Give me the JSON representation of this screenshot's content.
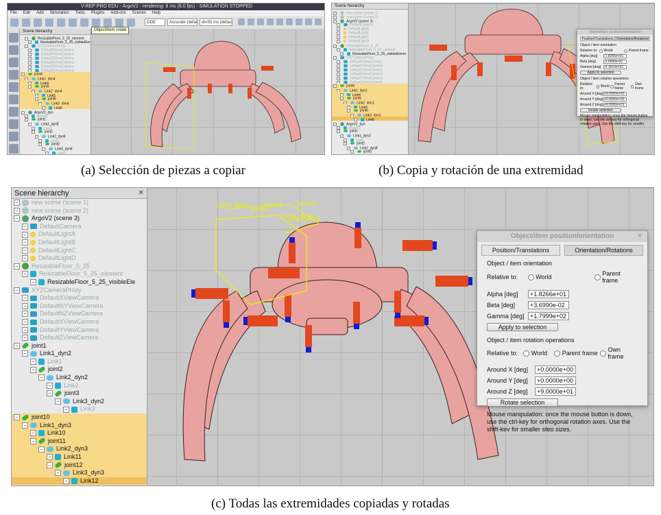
{
  "captions": {
    "a": "(a) Selección de piezas a copiar",
    "b": "(b) Copia y rotación de una extremidad",
    "c": "(c) Todas las extremidades copiadas y rotadas"
  },
  "panel_a": {
    "window_title": "V-REP PRO EDU - ArgoV2 - rendering: 8 ms (8.0 fps) - SIMULATION STOPPED",
    "menu": [
      "File",
      "Edit",
      "Add",
      "Simulation",
      "Tools",
      "Plugins",
      "Add-ons",
      "Scenes",
      "Help"
    ],
    "tooltip": "Object/item rotate",
    "engine_select": "ODE",
    "accuracy_select": "Accurate (defau",
    "dt_select": "dt=50 ms (default)",
    "hierarchy_title": "Scene hierarchy",
    "rows": [
      {
        "t": "ResizableFloor_5_25_element",
        "d": 1,
        "ic": "floor",
        "s": ""
      },
      {
        "t": "ResizableFloor_5_25_visibleEleme",
        "d": 2,
        "ic": "shape",
        "s": ""
      },
      {
        "t": "XYZCameraProxy",
        "d": 1,
        "ic": "cam",
        "s": "grey"
      },
      {
        "t": "DefaultXViewCamera",
        "d": 2,
        "ic": "cam",
        "s": "grey"
      },
      {
        "t": "DefaultYViewCamera",
        "d": 2,
        "ic": "cam",
        "s": "grey"
      },
      {
        "t": "DefaultZViewCamera",
        "d": 2,
        "ic": "cam",
        "s": "grey"
      },
      {
        "t": "DefaultXViewCamera",
        "d": 2,
        "ic": "cam",
        "s": "grey"
      },
      {
        "t": "DefaultYViewCamera",
        "d": 2,
        "ic": "cam",
        "s": "grey"
      },
      {
        "t": "DefaultZViewCamera",
        "d": 2,
        "ic": "cam",
        "s": "grey"
      },
      {
        "t": "joint4",
        "d": 0,
        "ic": "joint",
        "s": "sel"
      },
      {
        "t": "Link1_dyn4",
        "d": 1,
        "ic": "link",
        "s": "sel"
      },
      {
        "t": "Link4",
        "d": 2,
        "ic": "shape",
        "s": "sel"
      },
      {
        "t": "joint5",
        "d": 2,
        "ic": "joint",
        "s": "sel"
      },
      {
        "t": "Link2_dyn4",
        "d": 3,
        "ic": "link",
        "s": "sel"
      },
      {
        "t": "Link5",
        "d": 4,
        "ic": "shape",
        "s": "sel"
      },
      {
        "t": "joint6",
        "d": 4,
        "ic": "joint",
        "s": "sel"
      },
      {
        "t": "Link3_dyn4",
        "d": 5,
        "ic": "link",
        "s": "sel"
      },
      {
        "t": "Link6",
        "d": 6,
        "ic": "shape",
        "s": "sel"
      },
      {
        "t": "ArgoV2_dyn",
        "d": 0,
        "ic": "scene",
        "s": ""
      },
      {
        "t": "ArgoV2",
        "d": 1,
        "ic": "shape",
        "s": "grey"
      },
      {
        "t": "joint1",
        "d": 1,
        "ic": "joint",
        "s": ""
      },
      {
        "t": "Link1_dyn8",
        "d": 2,
        "ic": "link",
        "s": ""
      },
      {
        "t": "Link1",
        "d": 3,
        "ic": "shape",
        "s": "grey"
      },
      {
        "t": "joint2",
        "d": 3,
        "ic": "joint",
        "s": ""
      },
      {
        "t": "Link2_dyn8",
        "d": 4,
        "ic": "link",
        "s": ""
      },
      {
        "t": "Link2",
        "d": 5,
        "ic": "shape",
        "s": "grey"
      },
      {
        "t": "joint3",
        "d": 5,
        "ic": "joint",
        "s": ""
      },
      {
        "t": "Link3_dyn8",
        "d": 6,
        "ic": "link",
        "s": ""
      },
      {
        "t": "Link3",
        "d": 7,
        "ic": "shape",
        "s": "grey"
      }
    ]
  },
  "panel_b": {
    "hierarchy_title": "Scene hierarchy",
    "rows": [
      {
        "t": "new scene (scene 1)",
        "d": 0,
        "ic": "grey",
        "s": "grey"
      },
      {
        "t": "new scene (scene 2)",
        "d": 0,
        "ic": "grey",
        "s": "grey"
      },
      {
        "t": "ArgoV2 (scene 3)",
        "d": 0,
        "ic": "scene",
        "s": ""
      },
      {
        "t": "DefaultCamera",
        "d": 1,
        "ic": "cam",
        "s": "grey"
      },
      {
        "t": "DefaultLightA",
        "d": 1,
        "ic": "light",
        "s": "grey"
      },
      {
        "t": "DefaultLightB",
        "d": 1,
        "ic": "light",
        "s": "grey"
      },
      {
        "t": "DefaultLightC",
        "d": 1,
        "ic": "light",
        "s": "grey"
      },
      {
        "t": "DefaultLightD",
        "d": 1,
        "ic": "light",
        "s": "grey"
      },
      {
        "t": "ResizableFloor_5_25",
        "d": 0,
        "ic": "floor",
        "s": "grey"
      },
      {
        "t": "ResizableFloor_5_25_element",
        "d": 1,
        "ic": "shape",
        "s": "grey"
      },
      {
        "t": "ResizableFloor_5_25_visibleEleme",
        "d": 2,
        "ic": "shape",
        "s": ""
      },
      {
        "t": "XYZCameraProxy",
        "d": 0,
        "ic": "cam",
        "s": "grey"
      },
      {
        "t": "DefaultXViewCamera",
        "d": 1,
        "ic": "cam",
        "s": "grey"
      },
      {
        "t": "DefaultYViewCamera",
        "d": 1,
        "ic": "cam",
        "s": "grey"
      },
      {
        "t": "DefaultZViewCamera",
        "d": 1,
        "ic": "cam",
        "s": "grey"
      },
      {
        "t": "DefaultXViewCamera",
        "d": 1,
        "ic": "cam",
        "s": "grey"
      },
      {
        "t": "DefaultYViewCamera",
        "d": 1,
        "ic": "cam",
        "s": "grey"
      },
      {
        "t": "DefaultZViewCamera",
        "d": 1,
        "ic": "cam",
        "s": "grey"
      },
      {
        "t": "joint4",
        "d": 0,
        "ic": "joint",
        "s": "sel"
      },
      {
        "t": "Link1_dyn1",
        "d": 1,
        "ic": "link",
        "s": "sel"
      },
      {
        "t": "Link4",
        "d": 2,
        "ic": "shape",
        "s": "sel"
      },
      {
        "t": "joint5",
        "d": 2,
        "ic": "joint",
        "s": "sel"
      },
      {
        "t": "Link2_dyn1",
        "d": 3,
        "ic": "link",
        "s": "sel"
      },
      {
        "t": "Link5",
        "d": 4,
        "ic": "shape",
        "s": "sel"
      },
      {
        "t": "joint6",
        "d": 4,
        "ic": "joint",
        "s": "sel"
      },
      {
        "t": "Link3_dyn1",
        "d": 5,
        "ic": "link",
        "s": "sel"
      },
      {
        "t": "Link6",
        "d": 6,
        "ic": "shape",
        "s": "sel2"
      },
      {
        "t": "ArgoV2_dyn",
        "d": 0,
        "ic": "scene",
        "s": ""
      },
      {
        "t": "ArgoV2",
        "d": 1,
        "ic": "shape",
        "s": "grey"
      },
      {
        "t": "joint1",
        "d": 1,
        "ic": "joint",
        "s": ""
      },
      {
        "t": "Link1_dyn3",
        "d": 2,
        "ic": "link",
        "s": ""
      },
      {
        "t": "Link1",
        "d": 3,
        "ic": "shape",
        "s": "grey"
      },
      {
        "t": "joint2",
        "d": 3,
        "ic": "joint",
        "s": ""
      },
      {
        "t": "Link2_dyn8",
        "d": 4,
        "ic": "link",
        "s": ""
      },
      {
        "t": "joint3",
        "d": 5,
        "ic": "joint",
        "s": ""
      }
    ],
    "dialog": {
      "title": "Object/item position/orientation",
      "tab1": "Position/Translations",
      "tab2": "Orientation/Rotations",
      "orient_header": "Object / item orientation",
      "relative_to": "Relative to:",
      "world": "World",
      "parent_frame": "Parent frame",
      "own_frame": "Own frame",
      "alpha_label": "Alpha [deg]",
      "alpha_value": "-1.8266e+01",
      "beta_label": "Beta [deg]",
      "beta_value": "-3.6990e-02",
      "gamma_label": "Gamma [deg]",
      "gamma_value": "-5.1615e+01",
      "apply": "Apply to selection",
      "rot_header": "Object / item rotation operations",
      "around_x_label": "Around X [deg]",
      "around_x_value": "+0.0000e+00",
      "around_y_label": "Around Y [deg]",
      "around_y_value": "+0.0000e+00",
      "around_z_label": "Around Z [deg]",
      "around_z_value": "+9.0000e+01",
      "rotate": "Rotate selection",
      "help": "Mouse manipulation: once the mouse button is down, use the ctrl-key for orthogonal rotation axes. Use the shift-key for smaller step sizes."
    }
  },
  "panel_c": {
    "hierarchy_title": "Scene hierarchy",
    "close_glyph": "✕",
    "rows": [
      {
        "t": "new scene (scene 1)",
        "d": 0,
        "ic": "grey",
        "s": "grey"
      },
      {
        "t": "new scene (scene 2)",
        "d": 0,
        "ic": "grey",
        "s": "grey"
      },
      {
        "t": "ArgoV2 (scene 3)",
        "d": 0,
        "ic": "scene",
        "s": ""
      },
      {
        "t": "DefaultCamera",
        "d": 1,
        "ic": "cam",
        "s": "grey"
      },
      {
        "t": "DefaultLightA",
        "d": 1,
        "ic": "light",
        "s": "grey"
      },
      {
        "t": "DefaultLightB",
        "d": 1,
        "ic": "light",
        "s": "grey"
      },
      {
        "t": "DefaultLightC",
        "d": 1,
        "ic": "light",
        "s": "grey"
      },
      {
        "t": "DefaultLightD",
        "d": 1,
        "ic": "light",
        "s": "grey"
      },
      {
        "t": "ResizableFloor_5_25",
        "d": 0,
        "ic": "floor",
        "s": "grey"
      },
      {
        "t": "ResizableFloor_5_25_element",
        "d": 1,
        "ic": "shape",
        "s": "grey"
      },
      {
        "t": "ResizableFloor_5_25_visibleEle",
        "d": 2,
        "ic": "shape",
        "s": ""
      },
      {
        "t": "XYZCameraProxy",
        "d": 0,
        "ic": "cam",
        "s": "grey"
      },
      {
        "t": "DefaultXViewCamera",
        "d": 1,
        "ic": "cam",
        "s": "grey"
      },
      {
        "t": "DefaultNYViewCamera",
        "d": 1,
        "ic": "cam",
        "s": "grey"
      },
      {
        "t": "DefaultNZViewCamera",
        "d": 1,
        "ic": "cam",
        "s": "grey"
      },
      {
        "t": "DefaultXViewCamera",
        "d": 1,
        "ic": "cam",
        "s": "grey"
      },
      {
        "t": "DefaultYViewCamera",
        "d": 1,
        "ic": "cam",
        "s": "grey"
      },
      {
        "t": "DefaultZViewCamera",
        "d": 1,
        "ic": "cam",
        "s": "grey"
      },
      {
        "t": "joint1",
        "d": 0,
        "ic": "joint",
        "s": ""
      },
      {
        "t": "Link1_dyn2",
        "d": 1,
        "ic": "link",
        "s": ""
      },
      {
        "t": "Link1",
        "d": 2,
        "ic": "shape",
        "s": "grey"
      },
      {
        "t": "joint2",
        "d": 2,
        "ic": "joint",
        "s": ""
      },
      {
        "t": "Link2_dyn2",
        "d": 3,
        "ic": "link",
        "s": ""
      },
      {
        "t": "Link2",
        "d": 4,
        "ic": "shape",
        "s": "grey"
      },
      {
        "t": "joint3",
        "d": 4,
        "ic": "joint",
        "s": ""
      },
      {
        "t": "Link3_dyn2",
        "d": 5,
        "ic": "link",
        "s": ""
      },
      {
        "t": "Link3",
        "d": 6,
        "ic": "shape",
        "s": "grey"
      },
      {
        "t": "joint10",
        "d": 0,
        "ic": "joint",
        "s": "sel"
      },
      {
        "t": "Link1_dyn3",
        "d": 1,
        "ic": "link",
        "s": "sel"
      },
      {
        "t": "Link10",
        "d": 2,
        "ic": "shape",
        "s": "sel"
      },
      {
        "t": "joint11",
        "d": 2,
        "ic": "joint",
        "s": "sel"
      },
      {
        "t": "Link2_dyn3",
        "d": 3,
        "ic": "link",
        "s": "sel"
      },
      {
        "t": "Link11",
        "d": 4,
        "ic": "shape",
        "s": "sel"
      },
      {
        "t": "joint12",
        "d": 4,
        "ic": "joint",
        "s": "sel"
      },
      {
        "t": "Link3_dyn3",
        "d": 5,
        "ic": "link",
        "s": "sel"
      },
      {
        "t": "Link12",
        "d": 6,
        "ic": "shape",
        "s": "sel2"
      }
    ],
    "labels3d": [
      "Link3_dyn3",
      "joint10",
      "joint14",
      "Link1_dyn3",
      "joint15",
      "Link1_dyn3"
    ],
    "dialog": {
      "title": "Object/item position/orientation",
      "tab1": "Position/Translations",
      "tab2": "Orientation/Rotations",
      "orient_header": "Object / item orientation",
      "relative_to": "Relative to:",
      "world": "World",
      "parent_frame": "Parent frame",
      "own_frame": "Own frame",
      "alpha_label": "Alpha [deg]",
      "alpha_value": "+1.8266e+01",
      "beta_label": "Beta [deg]",
      "beta_value": "+3.6990e-02",
      "gamma_label": "Gamma [deg]",
      "gamma_value": "+1.7999e+02",
      "apply": "Apply to selection",
      "rot_header": "Object / item rotation operations",
      "around_x_label": "Around X [deg]",
      "around_x_value": "+0.0000e+00",
      "around_y_label": "Around Y [deg]",
      "around_y_value": "+0.0000e+00",
      "around_z_label": "Around Z [deg]",
      "around_z_value": "+9.0000e+01",
      "rotate": "Rotate selection",
      "help": "Mouse manipulation: once the mouse button is down, use the ctrl-key for orthogonal rotation axes. Use the shift-key for smaller step sizes."
    }
  },
  "colors": {
    "robot_body": "#e8a3a0",
    "robot_edge": "#3a1f1f",
    "actuator": "#e2471e",
    "actuator_tip": "#0a1ed8",
    "selection_box": "#f0f000",
    "hierarchy_sel": "#f8d98a"
  }
}
